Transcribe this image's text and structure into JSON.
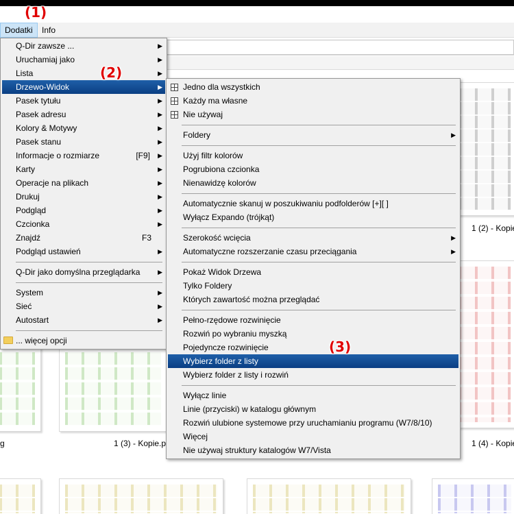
{
  "menubar": {
    "dodatki": "Dodatki",
    "info": "Info"
  },
  "callouts": {
    "c1": "(1)",
    "c2": "(2)",
    "c3": "(3)"
  },
  "thumbnails": {
    "label_1_2": "1 (2) - Kopie",
    "label_1_3": "1 (3) - Kopie.p",
    "label_1_4": "1 (4) - Kopie",
    "label_g": "g",
    "colors": {
      "gray": "#cfcfcf",
      "green": "#cfe8c5",
      "red": "#f2c4c4",
      "yellow": "#ece6bf",
      "blue": "#c8c8f0"
    }
  },
  "main_menu": {
    "items": [
      {
        "label": "Q-Dir zawsze ...",
        "arrow": true
      },
      {
        "label": "Uruchamiaj jako",
        "arrow": true
      },
      {
        "label": "Lista",
        "arrow": true
      },
      {
        "label": "Drzewo-Widok",
        "arrow": true,
        "highlight": true
      },
      {
        "label": "Pasek tytułu",
        "arrow": true
      },
      {
        "label": "Pasek adresu",
        "arrow": true
      },
      {
        "label": "Kolory & Motywy",
        "arrow": true
      },
      {
        "label": "Pasek stanu",
        "arrow": true
      },
      {
        "label": "Informacje o rozmiarze",
        "shortcut": "[F9]",
        "arrow": true
      },
      {
        "label": "Karty",
        "arrow": true
      },
      {
        "label": "Operacje na plikach",
        "arrow": true
      },
      {
        "label": "Drukuj",
        "arrow": true
      },
      {
        "label": "Podgląd",
        "arrow": true
      },
      {
        "label": "Czcionka",
        "arrow": true
      },
      {
        "label": "Znajdź",
        "shortcut": "F3"
      },
      {
        "label": "Podgląd ustawień",
        "arrow": true
      },
      {
        "label": "Q-Dir jako domyślna przeglądarka",
        "arrow": true
      },
      {
        "label": "System",
        "arrow": true
      },
      {
        "label": "Sieć",
        "arrow": true
      },
      {
        "label": "Autostart",
        "arrow": true
      },
      {
        "label": "... więcej opcji"
      }
    ]
  },
  "sub_menu": {
    "items": [
      {
        "label": "Jedno dla wszystkich",
        "check": true
      },
      {
        "label": "Każdy ma własne",
        "check": true
      },
      {
        "label": "Nie używaj",
        "check": true
      },
      {
        "label": "Foldery",
        "arrow": true
      },
      {
        "label": "Użyj filtr kolorów"
      },
      {
        "label": "Pogrubiona czcionka"
      },
      {
        "label": "Nienawidzę kolorów"
      },
      {
        "label": "Automatycznie skanuj w poszukiwaniu podfolderów [+][ ]"
      },
      {
        "label": "Wyłącz Expando (trójkąt)"
      },
      {
        "label": "Szerokość wcięcia",
        "arrow": true
      },
      {
        "label": "Automatyczne rozszerzanie czasu przeciągania",
        "arrow": true
      },
      {
        "label": "Pokaż Widok Drzewa"
      },
      {
        "label": "Tylko Foldery"
      },
      {
        "label": "Których zawartość można przeglądać"
      },
      {
        "label": "Pełno-rzędowe rozwinięcie"
      },
      {
        "label": "Rozwiń po wybraniu myszką"
      },
      {
        "label": "Pojedyncze rozwinięcie"
      },
      {
        "label": "Wybierz folder z listy",
        "highlight": true
      },
      {
        "label": "Wybierz folder z listy i rozwiń"
      },
      {
        "label": "Wyłącz linie"
      },
      {
        "label": "Linie (przyciski) w katalogu głównym"
      },
      {
        "label": "Rozwiń ulubione systemowe przy uruchamianiu programu (W7/8/10)"
      },
      {
        "label": "Więcej"
      },
      {
        "label": "Nie używaj struktury katalogów W7/Vista"
      }
    ]
  }
}
